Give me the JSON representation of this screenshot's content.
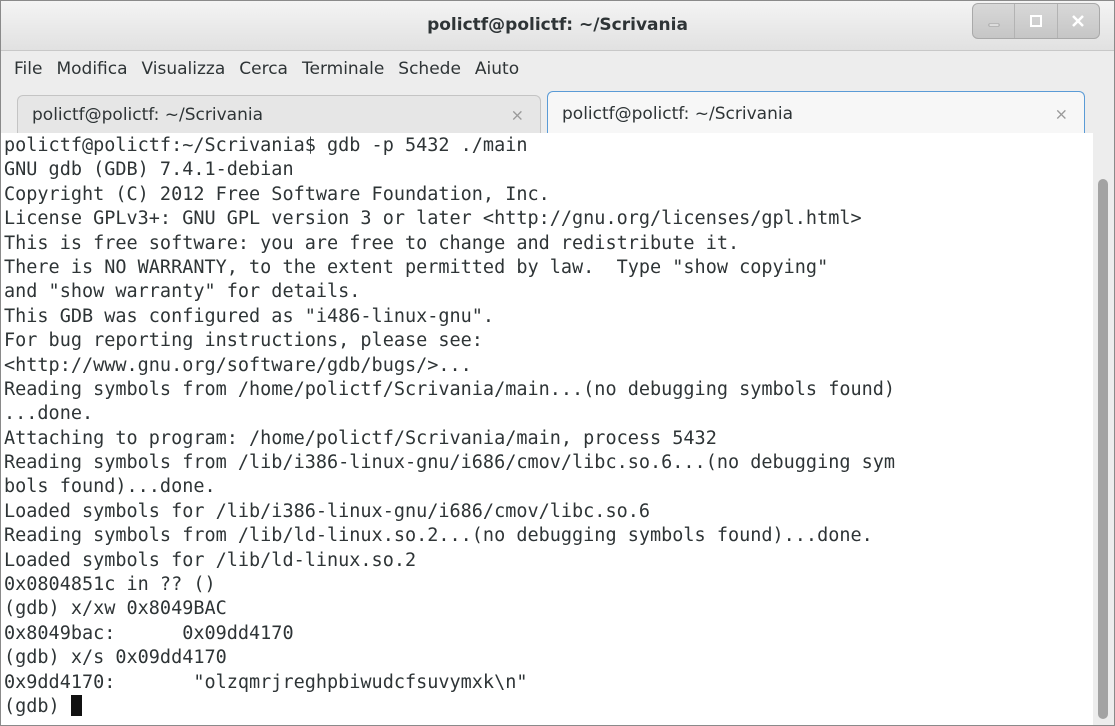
{
  "window": {
    "title": "polictf@polictf: ~/Scrivania"
  },
  "menubar": {
    "items": [
      "File",
      "Modifica",
      "Visualizza",
      "Cerca",
      "Terminale",
      "Schede",
      "Aiuto"
    ]
  },
  "tabs": [
    {
      "label": "polictf@polictf: ~/Scrivania",
      "close": "×",
      "active": false
    },
    {
      "label": "polictf@polictf: ~/Scrivania",
      "close": "×",
      "active": true
    }
  ],
  "terminal": {
    "lines": [
      "polictf@polictf:~/Scrivania$ gdb -p 5432 ./main",
      "GNU gdb (GDB) 7.4.1-debian",
      "Copyright (C) 2012 Free Software Foundation, Inc.",
      "License GPLv3+: GNU GPL version 3 or later <http://gnu.org/licenses/gpl.html>",
      "This is free software: you are free to change and redistribute it.",
      "There is NO WARRANTY, to the extent permitted by law.  Type \"show copying\"",
      "and \"show warranty\" for details.",
      "This GDB was configured as \"i486-linux-gnu\".",
      "For bug reporting instructions, please see:",
      "<http://www.gnu.org/software/gdb/bugs/>...",
      "Reading symbols from /home/polictf/Scrivania/main...(no debugging symbols found)",
      "...done.",
      "Attaching to program: /home/polictf/Scrivania/main, process 5432",
      "Reading symbols from /lib/i386-linux-gnu/i686/cmov/libc.so.6...(no debugging sym",
      "bols found)...done.",
      "Loaded symbols for /lib/i386-linux-gnu/i686/cmov/libc.so.6",
      "Reading symbols from /lib/ld-linux.so.2...(no debugging symbols found)...done.",
      "Loaded symbols for /lib/ld-linux.so.2",
      "0x0804851c in ?? ()",
      "(gdb) x/xw 0x8049BAC",
      "0x8049bac:      0x09dd4170",
      "(gdb) x/s 0x09dd4170",
      "0x9dd4170:       \"olzqmrjreghpbiwudcfsuvymxk\\n\""
    ],
    "prompt": "(gdb) "
  }
}
